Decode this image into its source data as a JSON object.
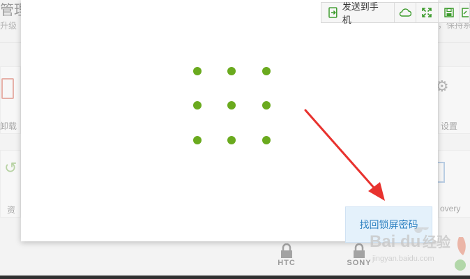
{
  "background": {
    "title": "管理",
    "subtitle_left": "升级",
    "subtitle_right": "，保持系",
    "labels": {
      "uninstall": "卸载",
      "settings": "设置",
      "resource": "资",
      "recovery": "overy"
    },
    "brands": [
      "HTC",
      "SONY"
    ]
  },
  "toolbar": {
    "send_to_phone": "发送到手机",
    "icons": [
      "cloud-icon",
      "fullscreen-icon",
      "save-icon",
      "export-icon"
    ]
  },
  "pattern_lock": {
    "rows": 3,
    "cols": 3,
    "dot_color": "#6aaa1e"
  },
  "recover_button": {
    "label": "找回锁屏密码"
  },
  "annotation": {
    "arrow_color": "#e8322e"
  },
  "watermark": {
    "text": "Baidu 经验",
    "url_text": "jingyan.baidu.com"
  }
}
